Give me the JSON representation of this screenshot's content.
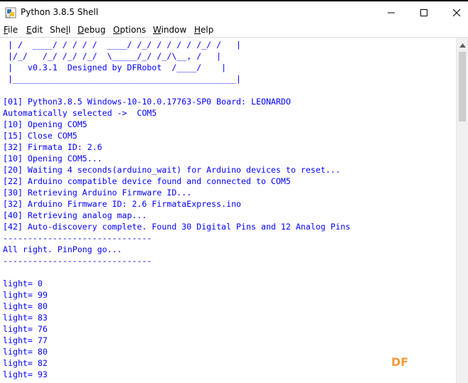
{
  "window": {
    "title": "Python 3.8.5 Shell",
    "icon": "python-idle-icon",
    "controls": {
      "minimize_icon": "minimize-icon",
      "maximize_icon": "maximize-icon",
      "close_icon": "close-icon"
    }
  },
  "menu": [
    {
      "mnemonic": "F",
      "rest": "ile"
    },
    {
      "mnemonic": "E",
      "rest": "dit"
    },
    {
      "pre": "She",
      "mnemonic": "l",
      "rest": "l"
    },
    {
      "mnemonic": "D",
      "rest": "ebug"
    },
    {
      "mnemonic": "O",
      "rest": "ptions"
    },
    {
      "mnemonic": "W",
      "rest": "indow"
    },
    {
      "mnemonic": "H",
      "rest": "elp"
    }
  ],
  "console": {
    "lines": [
      " | /  ____/ / / / /  ____/ /_/ / / / / /_/ /   |",
      " |/_/   /_/ /_/ /_/  \\_____/_/ /_/\\__, /   |",
      " |   v0.3.1  Designed by DFRobot  /____/    |",
      " |_____________________________________________|",
      "",
      "[01] Python3.8.5 Windows-10-10.0.17763-SP0 Board: LEONARDO",
      "Automatically selected ->  COM5",
      "[10] Opening COM5",
      "[15] Close COM5",
      "[32] Firmata ID: 2.6",
      "[10] Opening COM5...",
      "[20] Waiting 4 seconds(arduino_wait) for Arduino devices to reset...",
      "[22] Arduino compatible device found and connected to COM5",
      "[30] Retrieving Arduino Firmware ID...",
      "[32] Arduino Firmware ID: 2.6 FirmataExpress.ino",
      "[40] Retrieving analog map...",
      "[42] Auto-discovery complete. Found 30 Digital Pins and 12 Analog Pins",
      "------------------------------",
      "All right. PinPong go...",
      "------------------------------",
      "",
      "light= 0",
      "light= 99",
      "light= 80",
      "light= 83",
      "light= 76",
      "light= 77",
      "light= 80",
      "light= 82",
      "light= 93"
    ],
    "colors": {
      "system_output": "#0000ff",
      "program_output": "#000000"
    }
  },
  "scrollbar": {
    "up_icon": "scroll-up-arrow-icon"
  },
  "watermark": "DF",
  "colors": {
    "watermark": "#f39a3c"
  }
}
